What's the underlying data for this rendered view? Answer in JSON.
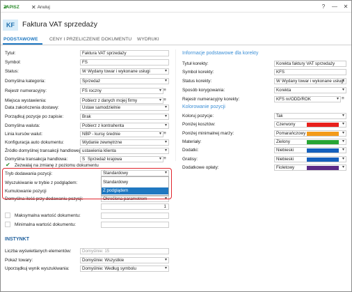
{
  "toolbar": {
    "save_label": "ZAPISZ",
    "cancel_label": "Anuluj",
    "help": "?",
    "minimize": "—",
    "close": "✕",
    "save_icon": "check-icon",
    "cancel_icon": "close-icon"
  },
  "header": {
    "badge": "KF",
    "title": "Faktura VAT sprzedaży"
  },
  "tabs": [
    "PODSTAWOWE",
    "CENY I PRZELICZENIE DOKUMENTU",
    "WYDRUKI"
  ],
  "left": {
    "rows": [
      {
        "label": "Tytuł:",
        "value": "Faktura VAT sprzedaży"
      },
      {
        "label": "Symbol:",
        "value": "FS"
      },
      {
        "label": "Status:",
        "prefix": "W",
        "value": "Wydany towar i wykonane usługi"
      },
      {
        "label": "Domyślna kategoria:",
        "value": "Sprzedaż"
      },
      {
        "label": "Rejestr numeracyjny:",
        "value": "FS roczny"
      },
      {
        "label": "Miejsca wystawienia:",
        "value": "Pobierz z danych mojej firmy"
      },
      {
        "label": "Data zakończenia dostawy:",
        "value": "Ustaw samodzielnie"
      },
      {
        "label": "Porządkuj pozycje po zapisie:",
        "value": "Brak"
      },
      {
        "label": "Domyślna waluta:",
        "value": "Pobierz z kontrahenta"
      },
      {
        "label": "Linia kursów walut:",
        "value": "NBP - kursy średnie"
      },
      {
        "label": "Konfiguracja auto dokumentu:",
        "value": "Wydanie zewnętrzne"
      },
      {
        "label": "Źródło domyślnej transakcji handlowej:",
        "value": "ustawienia klienta"
      },
      {
        "label": "Domyślna transakcja handlowa:",
        "prefix": "S",
        "value": "Sprzedaż krajowa"
      }
    ],
    "allow_change_label": "Zezwalaj na zmianę z poziomu dokumentu",
    "tryb_label": "Tryb dodawania pozycji:",
    "tryb_value": "Standardowy",
    "wyszukiwanie_label": "Wyszukiwanie w trybie z podglądem:",
    "kumulowanie_label": "Kumulowanie pozycji",
    "domyslna_ilosc_label": "Domyślna ilość przy dodawaniu pozycji:",
    "domyslna_ilosc_value": "Określona parametrem",
    "quantity_value": "1",
    "max_label": "Maksymalna wartość dokumentu:",
    "min_label": "Minimalna wartość dokumentu:",
    "dropdown_options": [
      "Standardowy",
      "Z podglądem"
    ]
  },
  "right": {
    "info_title": "Informacje podstawowe dla korekty",
    "rows": [
      {
        "label": "Tytuł korekty:",
        "value": "Korekta faktury VAT sprzedaży"
      },
      {
        "label": "Symbol korekty:",
        "value": "KFS"
      },
      {
        "label": "Status korekty:",
        "prefix": "W",
        "value": "Wydany towar i wykonane usługi"
      },
      {
        "label": "Sposób korygowania:",
        "value": "Korekta"
      },
      {
        "label": "Rejestr numeracyjny korekty:",
        "value": "KFS nr/ODD/ROK"
      }
    ],
    "color_title": "Kolorowanie pozycji",
    "colors": [
      {
        "label": "Koloruj pozycje:",
        "value": "Tak",
        "color": ""
      },
      {
        "label": "Poniżej kosztów:",
        "value": "Czerwony",
        "color": "#e8201c"
      },
      {
        "label": "Poniżej minimalnej marży:",
        "value": "Pomarańczowy",
        "color": "#f39b1a"
      },
      {
        "label": "Materiały:",
        "value": "Zielony",
        "color": "#27a534"
      },
      {
        "label": "Dodatki:",
        "value": "Niebieski",
        "color": "#1560bd"
      },
      {
        "label": "Gratisy:",
        "value": "Niebieski",
        "color": "#1560bd"
      },
      {
        "label": "Dodatkowe opłaty:",
        "value": "Fioletowy",
        "color": "#5b2a86"
      }
    ]
  },
  "instynkt": {
    "title": "INSTYNKT",
    "rows": [
      {
        "label": "Liczba wyświetlanych elementów:",
        "value": "Domyślnie: 15",
        "placeholder": true
      },
      {
        "label": "Pokaż towary:",
        "value": "Domyślnie: Wszystkie"
      },
      {
        "label": "Uporządkuj wynik wyszukiwania:",
        "value": "Domyślnie: Według symbolu"
      }
    ]
  }
}
